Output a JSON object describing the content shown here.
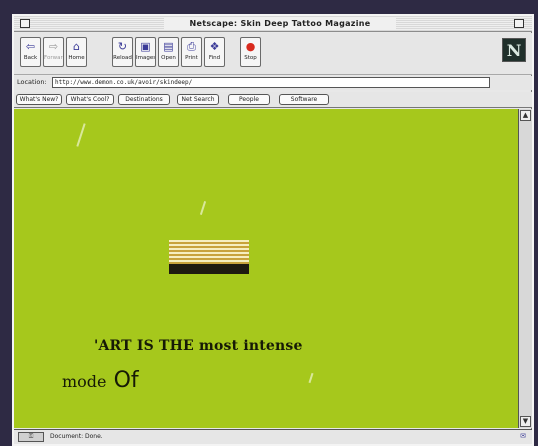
{
  "window": {
    "title": "Netscape: Skin Deep Tattoo Magazine"
  },
  "toolbar": {
    "back": "Back",
    "forward": "Forward",
    "home": "Home",
    "reload": "Reload",
    "images": "Images",
    "open": "Open",
    "print": "Print",
    "find": "Find",
    "stop": "Stop"
  },
  "logo": "N",
  "location": {
    "label": "Location:",
    "url": "http://www.demon.co.uk/avoir/skindeep/"
  },
  "directory": [
    "What's New?",
    "What's Cool?",
    "Destinations",
    "Net Search",
    "People",
    "Software"
  ],
  "page": {
    "headline_line1": "'ART IS THE most intense",
    "headline_mode": "mode",
    "headline_of": "Of"
  },
  "status": {
    "text": "Document: Done."
  },
  "colors": {
    "page_background": "#a6c81c",
    "stop_red": "#d82a1e"
  }
}
